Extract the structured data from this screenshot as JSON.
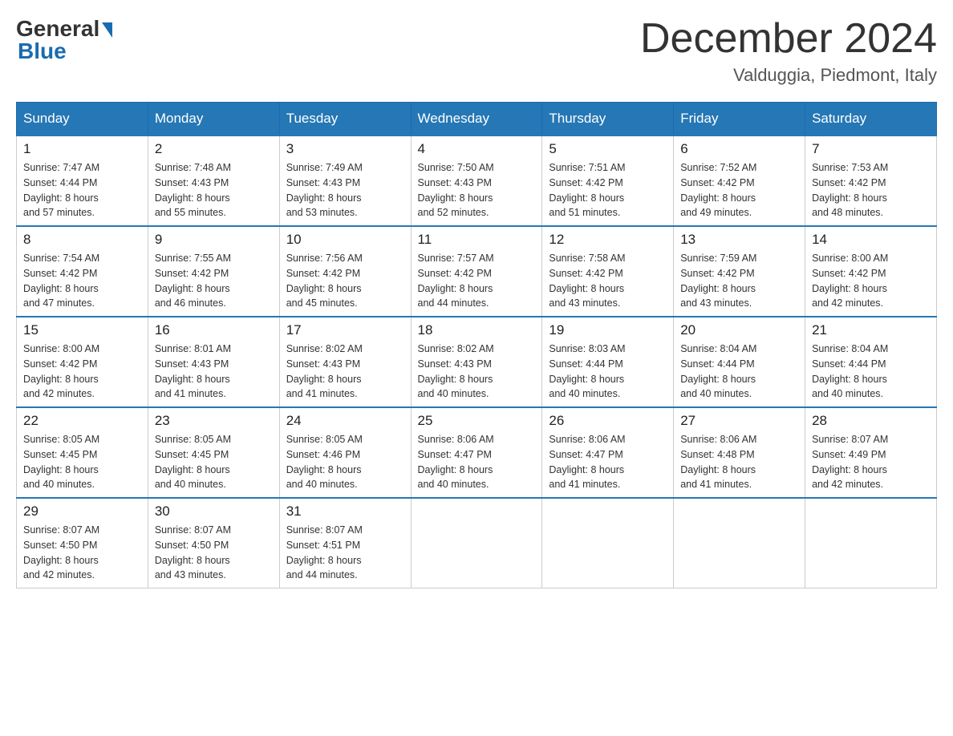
{
  "header": {
    "logo_general": "General",
    "logo_blue": "Blue",
    "month_title": "December 2024",
    "location": "Valduggia, Piedmont, Italy"
  },
  "days_of_week": [
    "Sunday",
    "Monday",
    "Tuesday",
    "Wednesday",
    "Thursday",
    "Friday",
    "Saturday"
  ],
  "weeks": [
    [
      {
        "day": "1",
        "sunrise": "7:47 AM",
        "sunset": "4:44 PM",
        "daylight": "8 hours and 57 minutes."
      },
      {
        "day": "2",
        "sunrise": "7:48 AM",
        "sunset": "4:43 PM",
        "daylight": "8 hours and 55 minutes."
      },
      {
        "day": "3",
        "sunrise": "7:49 AM",
        "sunset": "4:43 PM",
        "daylight": "8 hours and 53 minutes."
      },
      {
        "day": "4",
        "sunrise": "7:50 AM",
        "sunset": "4:43 PM",
        "daylight": "8 hours and 52 minutes."
      },
      {
        "day": "5",
        "sunrise": "7:51 AM",
        "sunset": "4:42 PM",
        "daylight": "8 hours and 51 minutes."
      },
      {
        "day": "6",
        "sunrise": "7:52 AM",
        "sunset": "4:42 PM",
        "daylight": "8 hours and 49 minutes."
      },
      {
        "day": "7",
        "sunrise": "7:53 AM",
        "sunset": "4:42 PM",
        "daylight": "8 hours and 48 minutes."
      }
    ],
    [
      {
        "day": "8",
        "sunrise": "7:54 AM",
        "sunset": "4:42 PM",
        "daylight": "8 hours and 47 minutes."
      },
      {
        "day": "9",
        "sunrise": "7:55 AM",
        "sunset": "4:42 PM",
        "daylight": "8 hours and 46 minutes."
      },
      {
        "day": "10",
        "sunrise": "7:56 AM",
        "sunset": "4:42 PM",
        "daylight": "8 hours and 45 minutes."
      },
      {
        "day": "11",
        "sunrise": "7:57 AM",
        "sunset": "4:42 PM",
        "daylight": "8 hours and 44 minutes."
      },
      {
        "day": "12",
        "sunrise": "7:58 AM",
        "sunset": "4:42 PM",
        "daylight": "8 hours and 43 minutes."
      },
      {
        "day": "13",
        "sunrise": "7:59 AM",
        "sunset": "4:42 PM",
        "daylight": "8 hours and 43 minutes."
      },
      {
        "day": "14",
        "sunrise": "8:00 AM",
        "sunset": "4:42 PM",
        "daylight": "8 hours and 42 minutes."
      }
    ],
    [
      {
        "day": "15",
        "sunrise": "8:00 AM",
        "sunset": "4:42 PM",
        "daylight": "8 hours and 42 minutes."
      },
      {
        "day": "16",
        "sunrise": "8:01 AM",
        "sunset": "4:43 PM",
        "daylight": "8 hours and 41 minutes."
      },
      {
        "day": "17",
        "sunrise": "8:02 AM",
        "sunset": "4:43 PM",
        "daylight": "8 hours and 41 minutes."
      },
      {
        "day": "18",
        "sunrise": "8:02 AM",
        "sunset": "4:43 PM",
        "daylight": "8 hours and 40 minutes."
      },
      {
        "day": "19",
        "sunrise": "8:03 AM",
        "sunset": "4:44 PM",
        "daylight": "8 hours and 40 minutes."
      },
      {
        "day": "20",
        "sunrise": "8:04 AM",
        "sunset": "4:44 PM",
        "daylight": "8 hours and 40 minutes."
      },
      {
        "day": "21",
        "sunrise": "8:04 AM",
        "sunset": "4:44 PM",
        "daylight": "8 hours and 40 minutes."
      }
    ],
    [
      {
        "day": "22",
        "sunrise": "8:05 AM",
        "sunset": "4:45 PM",
        "daylight": "8 hours and 40 minutes."
      },
      {
        "day": "23",
        "sunrise": "8:05 AM",
        "sunset": "4:45 PM",
        "daylight": "8 hours and 40 minutes."
      },
      {
        "day": "24",
        "sunrise": "8:05 AM",
        "sunset": "4:46 PM",
        "daylight": "8 hours and 40 minutes."
      },
      {
        "day": "25",
        "sunrise": "8:06 AM",
        "sunset": "4:47 PM",
        "daylight": "8 hours and 40 minutes."
      },
      {
        "day": "26",
        "sunrise": "8:06 AM",
        "sunset": "4:47 PM",
        "daylight": "8 hours and 41 minutes."
      },
      {
        "day": "27",
        "sunrise": "8:06 AM",
        "sunset": "4:48 PM",
        "daylight": "8 hours and 41 minutes."
      },
      {
        "day": "28",
        "sunrise": "8:07 AM",
        "sunset": "4:49 PM",
        "daylight": "8 hours and 42 minutes."
      }
    ],
    [
      {
        "day": "29",
        "sunrise": "8:07 AM",
        "sunset": "4:50 PM",
        "daylight": "8 hours and 42 minutes."
      },
      {
        "day": "30",
        "sunrise": "8:07 AM",
        "sunset": "4:50 PM",
        "daylight": "8 hours and 43 minutes."
      },
      {
        "day": "31",
        "sunrise": "8:07 AM",
        "sunset": "4:51 PM",
        "daylight": "8 hours and 44 minutes."
      },
      null,
      null,
      null,
      null
    ]
  ],
  "labels": {
    "sunrise": "Sunrise:",
    "sunset": "Sunset:",
    "daylight": "Daylight:"
  }
}
